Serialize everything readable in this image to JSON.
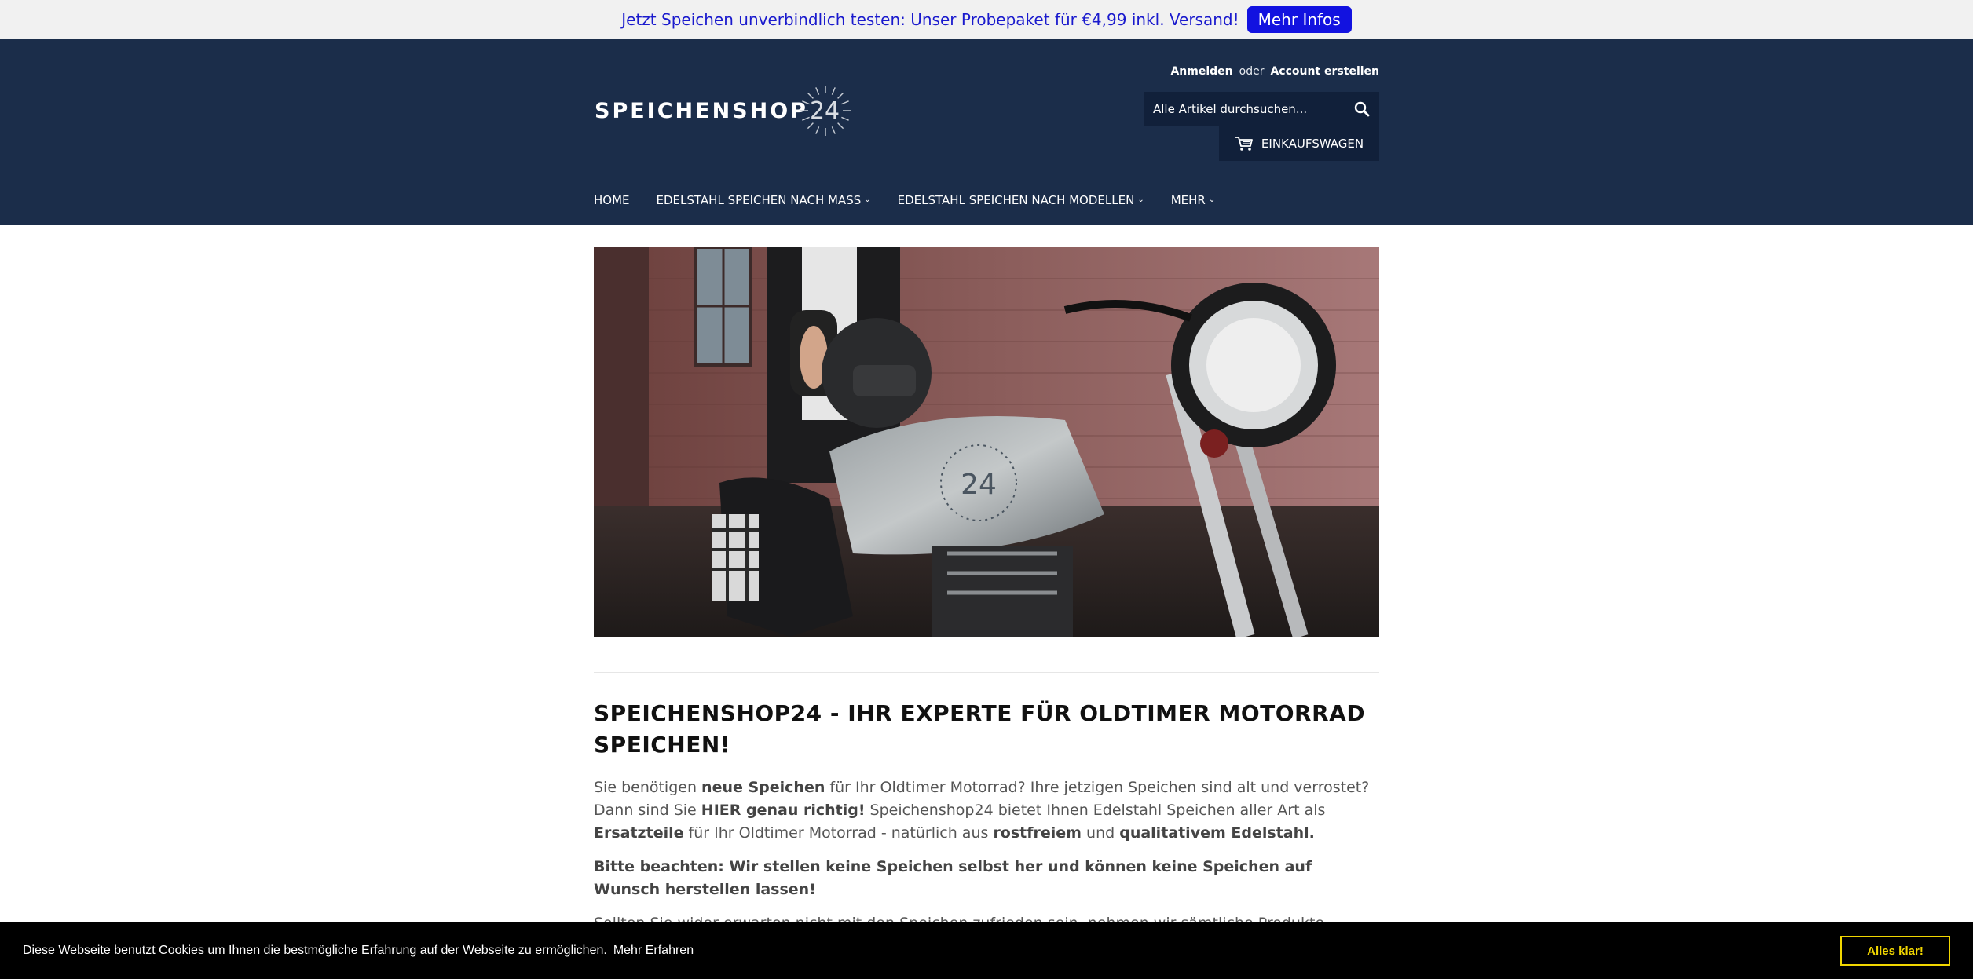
{
  "announcement": {
    "text": "Jetzt Speichen unverbindlich testen: Unser Probepaket für €4,99 inkl. Versand!",
    "button": "Mehr Infos"
  },
  "header": {
    "logo_text": "SPEICHENSHOP",
    "logo_number": "24",
    "login": "Anmelden",
    "or": "oder",
    "register": "Account erstellen",
    "search_placeholder": "Alle Artikel durchsuchen...",
    "cart_label": "EINKAUFSWAGEN"
  },
  "nav": {
    "items": [
      {
        "label": "HOME"
      },
      {
        "label": "EDELSTAHL SPEICHEN NACH MASS"
      },
      {
        "label": "EDELSTAHL SPEICHEN NACH MODELLEN"
      },
      {
        "label": "MEHR"
      }
    ]
  },
  "hero": {
    "tank_logo": "24"
  },
  "content": {
    "heading": "SPEICHENSHOP24 - IHR EXPERTE FÜR OLDTIMER MOTORRAD SPEICHEN!",
    "p1": {
      "t1": "Sie benötigen ",
      "b1": "neue Speichen",
      "t2": " für Ihr Oldtimer Motorrad? Ihre jetzigen Speichen sind alt und verrostet? Dann sind Sie ",
      "b2": "HIER genau richtig!",
      "t3": " Speichenshop24 bietet Ihnen Edelstahl Speichen aller Art als ",
      "b3": "Ersatzteile",
      "t4": " für Ihr Oldtimer Motorrad - natürlich aus ",
      "b4": "rostfreiem",
      "t5": " und ",
      "b5": "qualitativem Edelstahl."
    },
    "p2": "Bitte beachten: Wir stellen keine Speichen selbst her und können keine Speichen auf Wunsch herstellen lassen!",
    "p3": "Sollten Sie wider erwarten nicht mit den Speichen zufrieden sein, nehmen wir sämtliche Produkte zurück."
  },
  "cookie": {
    "message": "Diese Webseite benutzt Cookies um Ihnen die bestmögliche Erfahrung auf der Webseite zu ermöglichen.",
    "link": "Mehr Erfahren",
    "button": "Alles klar!"
  },
  "colors": {
    "header_bg": "#1b2d4a",
    "accent_blue": "#1212e0",
    "cookie_button": "#f1d600"
  }
}
